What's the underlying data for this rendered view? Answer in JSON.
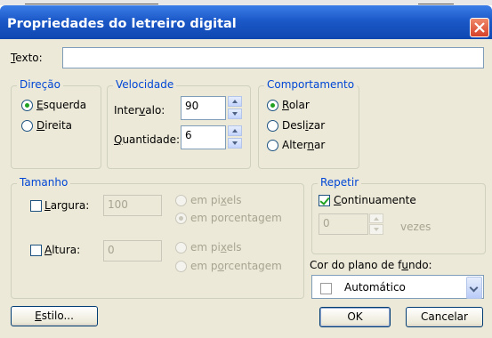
{
  "window": {
    "title": "Propriedades do letreiro digital"
  },
  "texto": {
    "label": "Texto:",
    "value": ""
  },
  "direcao": {
    "title": "Direção",
    "options": [
      {
        "label": "Esquerda",
        "checked": true
      },
      {
        "label": "Direita",
        "checked": false
      }
    ]
  },
  "velocidade": {
    "title": "Velocidade",
    "intervalo_label": "Intervalo:",
    "intervalo_value": "90",
    "quantidade_label": "Quantidade:",
    "quantidade_value": "6"
  },
  "comportamento": {
    "title": "Comportamento",
    "options": [
      {
        "label": "Rolar",
        "checked": true
      },
      {
        "label": "Deslizar",
        "checked": false
      },
      {
        "label": "Alternar",
        "checked": false
      }
    ]
  },
  "tamanho": {
    "title": "Tamanho",
    "largura_label": "Largura:",
    "largura_value": "100",
    "largura_units": [
      "em pixels",
      "em porcentagem"
    ],
    "altura_label": "Altura:",
    "altura_value": "0",
    "altura_units": [
      "em pixels",
      "em porcentagem"
    ]
  },
  "repetir": {
    "title": "Repetir",
    "continuamente_label": "Continuamente",
    "count_value": "0",
    "vezes_label": "vezes"
  },
  "cor": {
    "label": "Cor do plano de fundo:",
    "selected": "Automático"
  },
  "buttons": {
    "estilo": "Estilo...",
    "ok": "OK",
    "cancelar": "Cancelar"
  }
}
